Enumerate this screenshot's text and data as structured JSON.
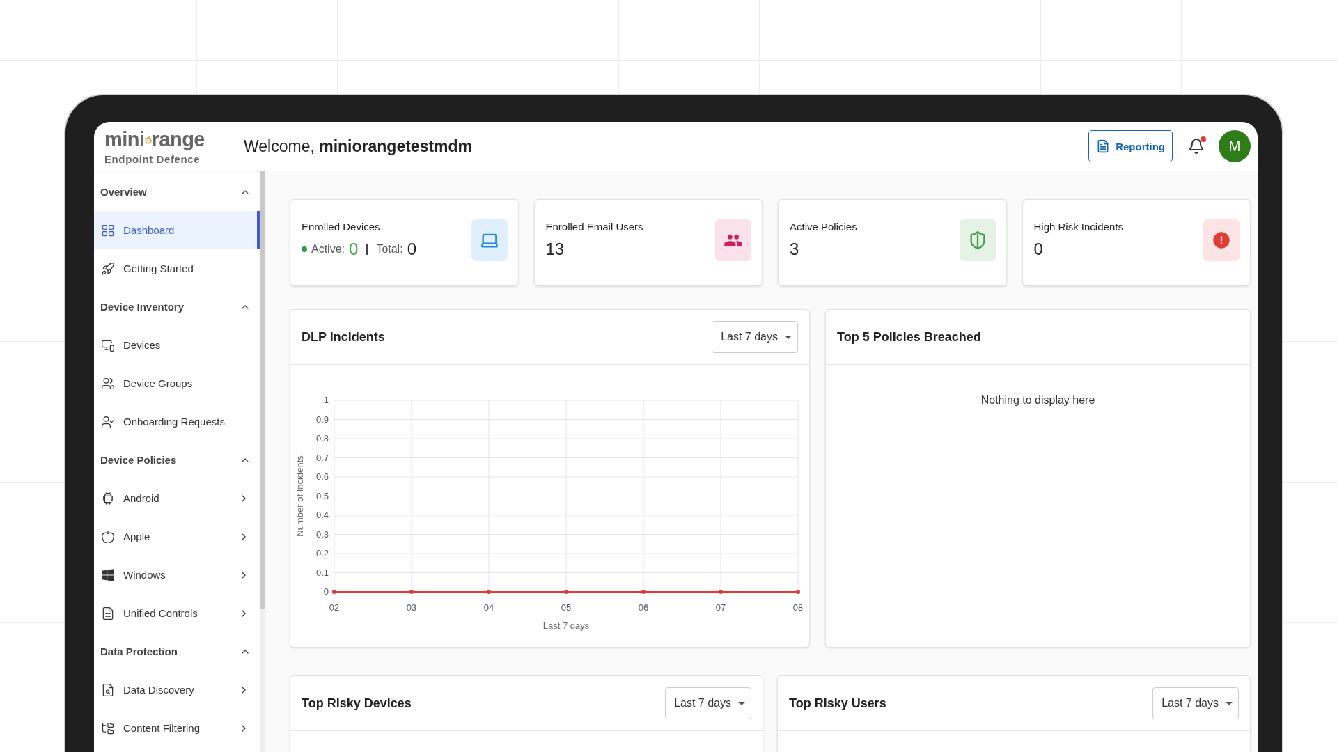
{
  "header": {
    "logo": {
      "word_start": "mini",
      "word_end": "range",
      "tagline": "Endpoint Defence"
    },
    "welcome": "Welcome, **miniorangetestmdm**",
    "reporting_button": "Reporting",
    "notifications": {
      "unread": true
    },
    "avatar": "M"
  },
  "sidebar": {
    "sections": [
      {
        "title": "Overview",
        "expanded": true,
        "items": [
          {
            "label": "Dashboard",
            "selected": true,
            "submenu": false
          },
          {
            "label": "Getting Started",
            "selected": false,
            "submenu": false
          }
        ]
      },
      {
        "title": "Device Inventory",
        "expanded": true,
        "items": [
          {
            "label": "Devices",
            "selected": false,
            "submenu": false
          },
          {
            "label": "Device Groups",
            "selected": false,
            "submenu": false
          },
          {
            "label": "Onboarding Requests",
            "selected": false,
            "submenu": false
          }
        ]
      },
      {
        "title": "Device Policies",
        "expanded": true,
        "items": [
          {
            "label": "Android",
            "selected": false,
            "submenu": true
          },
          {
            "label": "Apple",
            "selected": false,
            "submenu": true
          },
          {
            "label": "Windows",
            "selected": false,
            "submenu": true
          },
          {
            "label": "Unified Controls",
            "selected": false,
            "submenu": true
          }
        ]
      },
      {
        "title": "Data Protection",
        "expanded": true,
        "items": [
          {
            "label": "Data Discovery",
            "selected": false,
            "submenu": true
          },
          {
            "label": "Content Filtering",
            "selected": false,
            "submenu": true
          }
        ]
      }
    ]
  },
  "stats": [
    {
      "kind": "status",
      "title": "Enrolled Devices",
      "active_label": "Active:",
      "active": "0",
      "total_label": "Total:",
      "total": "0",
      "color": "#1e88e5"
    },
    {
      "kind": "count",
      "title": "Enrolled Email Users",
      "value": "13",
      "color": "#d81b60"
    },
    {
      "kind": "count",
      "title": "Active Policies",
      "value": "3",
      "color": "#43a047"
    },
    {
      "kind": "count",
      "title": "High Risk Incidents",
      "value": "0",
      "color": "#e53935"
    }
  ],
  "dlp_incidents": {
    "title": "DLP Incidents",
    "range": "Last 7 days",
    "chart_data": {
      "type": "line",
      "xlabel": "Last 7 days",
      "ylabel": "Number of Incidents",
      "categories": [
        "02",
        "03",
        "04",
        "05",
        "06",
        "07",
        "08"
      ],
      "grid": true,
      "series": [
        {
          "color": "#e53935",
          "marker": "circle",
          "values": [
            0,
            0,
            0,
            0,
            0,
            0,
            0
          ]
        }
      ],
      "ylim": [
        0,
        1
      ],
      "yticks": [
        0,
        0.1,
        0.2,
        0.3,
        0.4,
        0.5,
        0.6,
        0.7,
        0.8,
        0.9,
        1
      ]
    }
  },
  "top_policies": {
    "title": "Top 5 Policies Breached",
    "empty_message": "Nothing to display here"
  },
  "top_risky_devices": {
    "title": "Top Risky Devices",
    "range": "Last 7 days"
  },
  "top_risky_users": {
    "title": "Top Risky Users",
    "range": "Last 7 days"
  }
}
